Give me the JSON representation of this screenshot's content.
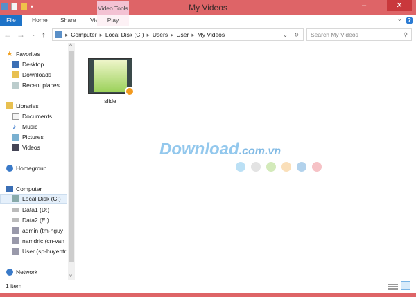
{
  "window": {
    "title": "My Videos",
    "contextual_tab_group": "Video Tools",
    "minimize": "–",
    "maximize": "☐",
    "close": "✕"
  },
  "ribbon": {
    "tabs": [
      "File",
      "Home",
      "Share",
      "View",
      "Play"
    ],
    "expand": "⌄",
    "help": "?"
  },
  "address": {
    "crumbs": [
      "Computer",
      "Local Disk (C:)",
      "Users",
      "User",
      "My Videos"
    ],
    "back": "←",
    "forward": "→",
    "up": "↑",
    "recent": "⌄",
    "refresh": "↻",
    "dropdown": "⌄"
  },
  "search": {
    "placeholder": "Search My Videos",
    "icon": "⚲"
  },
  "sidebar": {
    "favorites": {
      "label": "Favorites",
      "items": [
        "Desktop",
        "Downloads",
        "Recent places"
      ]
    },
    "libraries": {
      "label": "Libraries",
      "items": [
        "Documents",
        "Music",
        "Pictures",
        "Videos"
      ]
    },
    "homegroup": "Homegroup",
    "computer": {
      "label": "Computer",
      "items": [
        "Local Disk (C:)",
        "Data1 (D:)",
        "Data2 (E:)",
        "admin (tm-nguy",
        "namdric (cn-van",
        "User (sp-huyentr"
      ]
    },
    "network": "Network"
  },
  "files": [
    {
      "name": "slide"
    }
  ],
  "status": {
    "count": "1 item"
  },
  "watermark": {
    "text": "Download",
    "suffix": ".com.vn",
    "dot_colors": [
      "#8ecbee",
      "#d0d0d0",
      "#b5dc8c",
      "#f7c98a",
      "#7fb4e0",
      "#f09aa0"
    ]
  },
  "colors": {
    "titlebar": "#de6467",
    "accent": "#1e73c8"
  }
}
